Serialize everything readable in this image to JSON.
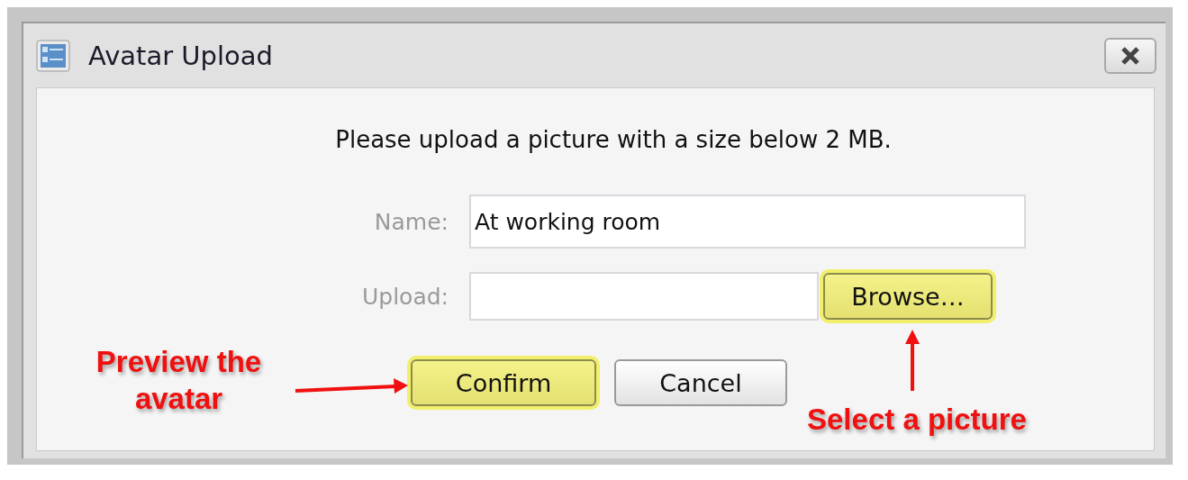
{
  "window": {
    "title": "Avatar Upload"
  },
  "message": "Please upload a picture with a size below 2 MB.",
  "fields": [
    {
      "label": "Name:",
      "value": "At working room"
    },
    {
      "label": "Upload:"
    }
  ],
  "browse_button": {
    "label": "Browse…",
    "highlighted": true
  },
  "buttons": [
    {
      "label": "Confirm",
      "highlighted": true
    },
    {
      "label": "Cancel",
      "highlighted": false
    }
  ],
  "annotations": [
    {
      "text": "Preview the avatar",
      "kind": "right"
    },
    {
      "text": "Select a picture",
      "kind": "up"
    }
  ]
}
